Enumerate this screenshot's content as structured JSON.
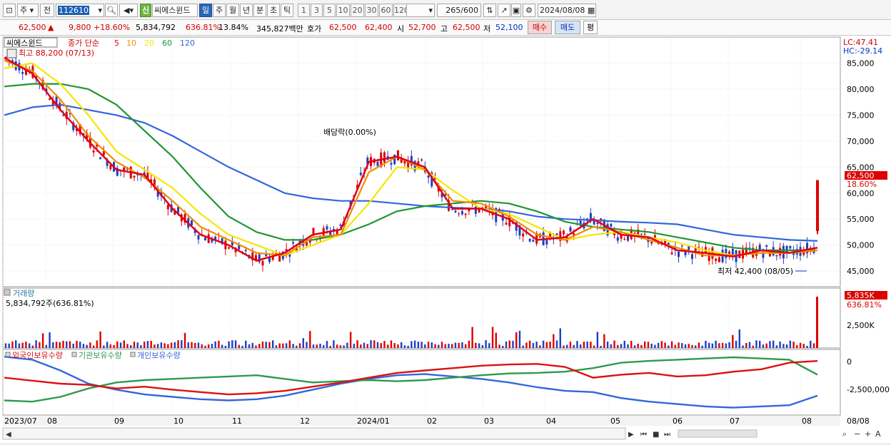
{
  "toolbar": {
    "market_select": "주",
    "prev_label": "전",
    "stock_code": "112610",
    "stock_name": "씨에스윈드",
    "new_badge": "신",
    "periods": [
      "일",
      "주",
      "월",
      "년",
      "분",
      "초",
      "틱"
    ],
    "selected_period": "일",
    "intervals": [
      "1",
      "3",
      "5",
      "10",
      "20",
      "30",
      "60",
      "120"
    ],
    "count": "265",
    "count_total": "/600",
    "date": "2024/08/08"
  },
  "quote": {
    "price": "62,500",
    "change_arrow": "▲",
    "change": "9,800",
    "change_pct": "+18.60%",
    "volume": "5,834,792",
    "volume_ratio": "636.81%",
    "turnover": "13.84%",
    "amount": "345,827백만",
    "bid_label": "호가",
    "ask": "62,500",
    "bid": "62,400",
    "open_label": "시",
    "open": "52,700",
    "high_label": "고",
    "high": "62,500",
    "low_label": "저",
    "low": "52,100",
    "buy_button": "매수",
    "sell_button": "매도",
    "extra_button": "평"
  },
  "price_panel": {
    "title": "씨에스윈드",
    "ma_label": "종가 단순",
    "ma_periods": [
      "5",
      "10",
      "20",
      "60",
      "120"
    ],
    "ma_colors": [
      "#e0001a",
      "#f08c00",
      "#f5e600",
      "#1e9632",
      "#3366dd"
    ],
    "highest": "최고 88,200 (07/13)",
    "lowest": "최저 42,400 (08/05)",
    "dividend": "배당락(0.00%)",
    "lc": "LC:47.41",
    "hc": "HC:-29.14",
    "current_price": "62,500",
    "current_pct": "18.60%",
    "y_ticks": [
      "85,000",
      "80,000",
      "75,000",
      "70,000",
      "65,000",
      "60,000",
      "55,000",
      "50,000",
      "45,000"
    ]
  },
  "volume_panel": {
    "title": "거래량",
    "value": "5,834,792주(636.81%)",
    "current": "5,835K",
    "current_pct": "636.81%",
    "y_tick": "2,500K"
  },
  "holding_panel": {
    "legend": [
      "외국인보유수량",
      "기관보유수량",
      "개인보유수량"
    ],
    "colors": [
      "#dd1111",
      "#2f9a4e",
      "#3366dd"
    ],
    "y_ticks": [
      "0",
      "-2,500,000"
    ]
  },
  "x_axis": {
    "labels": [
      "2023/07",
      "08",
      "09",
      "10",
      "11",
      "12",
      "2024/01",
      "02",
      "03",
      "04",
      "05",
      "06",
      "07",
      "08"
    ],
    "right_label": "08/08"
  },
  "chart_data": {
    "type": "line",
    "y_range": [
      42000,
      90000
    ],
    "ma_series": [
      {
        "name": "5",
        "values": [
          86000,
          83000,
          76000,
          70000,
          64500,
          63500,
          57000,
          52000,
          50000,
          47000,
          48500,
          52000,
          53000,
          66000,
          67000,
          65000,
          57000,
          57000,
          55000,
          51000,
          51500,
          55000,
          52000,
          51500,
          49000,
          48500,
          47800,
          49000,
          48500,
          49500
        ]
      },
      {
        "name": "10",
        "values": [
          85500,
          83500,
          78000,
          71000,
          66000,
          63000,
          58500,
          53500,
          51000,
          48500,
          48000,
          51500,
          52000,
          64000,
          67000,
          64500,
          58500,
          58000,
          55500,
          52000,
          51000,
          53500,
          52500,
          51000,
          49500,
          48000,
          48000,
          48500,
          48500,
          49000
        ]
      },
      {
        "name": "20",
        "values": [
          84000,
          85000,
          81000,
          75000,
          68000,
          64500,
          61000,
          56000,
          52000,
          50000,
          48000,
          50000,
          52000,
          58000,
          65000,
          64500,
          60500,
          57000,
          56000,
          53500,
          51000,
          52000,
          52500,
          51500,
          50500,
          49000,
          48000,
          48500,
          48500,
          49000
        ]
      },
      {
        "name": "60",
        "values": [
          80500,
          81000,
          81000,
          80000,
          77000,
          72000,
          67000,
          61000,
          55500,
          52500,
          51000,
          51000,
          52000,
          54000,
          56500,
          57500,
          58000,
          58500,
          58000,
          56500,
          54500,
          53500,
          53000,
          52500,
          51500,
          50500,
          49500,
          49000,
          49000,
          49000
        ]
      },
      {
        "name": "120",
        "values": [
          75000,
          76500,
          77000,
          76000,
          75000,
          73500,
          71000,
          68000,
          65000,
          62500,
          60000,
          59000,
          58500,
          58500,
          58000,
          57500,
          57200,
          57000,
          56500,
          55500,
          55000,
          54800,
          54500,
          54300,
          54000,
          53000,
          52000,
          51500,
          51000,
          50800
        ]
      }
    ]
  }
}
